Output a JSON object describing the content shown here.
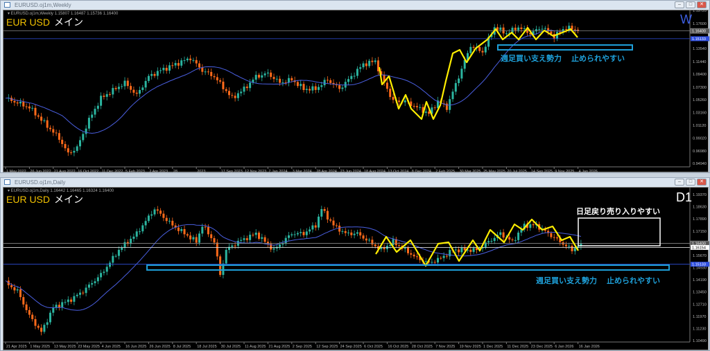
{
  "weekly": {
    "title": "EURUSD.oj1m,Weekly",
    "info": "▾ EURUSD.oj1m,Weekly  1.15807 1.16487 1.15736 1.16400",
    "symbol": "EUR USD",
    "label": "メイン",
    "timeframe": "W",
    "annotation": "週足買い支え勢力　 止められやすい",
    "current_price": "1.16400",
    "support_price": "1.15133"
  },
  "daily": {
    "title": "EURUSD.oj1m,Daily",
    "info": "▾ EURUSD.oj1m,Daily  1.16442 1.16465 1.16324 1.16400",
    "symbol": "EUR USD",
    "label": "メイン",
    "timeframe": "D1",
    "annotation": "週足買い支え勢力　 止められやすい",
    "annotation2": "日足戻り売り入りやすい",
    "current_price": "1.16400",
    "bid_price": "1.16154",
    "support_price": "1.15133"
  },
  "window_controls": {
    "minimize": "–",
    "maximize": "□",
    "close": "✕"
  },
  "colors": {
    "up": "#2bb5a0",
    "down": "#ff6a1a",
    "ma": "#4a5fe0",
    "zigzag": "#ffee00",
    "support": "#1e9fd8"
  },
  "chart_data": [
    {
      "type": "line",
      "title": "EURUSD Weekly",
      "ylim": [
        0.9494,
        1.1972
      ],
      "yticks": [
        "1.19720",
        "1.17600",
        "1.13540",
        "1.11440",
        "1.09400",
        "1.07300",
        "1.05260",
        "1.03160",
        "1.01120",
        "0.99020",
        "0.96980",
        "0.94940"
      ],
      "xticks": [
        "1 May 2022",
        "26 Jun 2022",
        "21 Aug 2022",
        "16 Oct 2022",
        "11 Dec 2022",
        "5 Feb 2023",
        "2 Apr 2023",
        "28",
        "2023",
        "17 Sep 2023",
        "12 Nov 2023",
        "7 Jan 2024",
        "3 Mar 2024",
        "28 Apr 2024",
        "23 Jun 2024",
        "18 Aug 2024",
        "13 Oct 2024",
        "8 Dec 2024",
        "2 Feb 2025",
        "30 Mar 2025",
        "25 May 2025",
        "20 Jul 2025",
        "14 Sep 2025",
        "9 Nov 2025",
        "4 Jan 2026"
      ],
      "n_bars": 193,
      "close_keypoints": [
        [
          0,
          1.055
        ],
        [
          8,
          1.04
        ],
        [
          12,
          1.02
        ],
        [
          18,
          0.99
        ],
        [
          21,
          0.965
        ],
        [
          24,
          0.975
        ],
        [
          28,
          1.02
        ],
        [
          32,
          1.055
        ],
        [
          40,
          1.08
        ],
        [
          44,
          1.06
        ],
        [
          48,
          1.09
        ],
        [
          52,
          1.1
        ],
        [
          62,
          1.12
        ],
        [
          66,
          1.1
        ],
        [
          70,
          1.09
        ],
        [
          76,
          1.055
        ],
        [
          80,
          1.07
        ],
        [
          84,
          1.09
        ],
        [
          88,
          1.095
        ],
        [
          92,
          1.08
        ],
        [
          96,
          1.085
        ],
        [
          100,
          1.07
        ],
        [
          104,
          1.07
        ],
        [
          108,
          1.085
        ],
        [
          112,
          1.07
        ],
        [
          116,
          1.09
        ],
        [
          120,
          1.11
        ],
        [
          124,
          1.115
        ],
        [
          126,
          1.09
        ],
        [
          130,
          1.05
        ],
        [
          134,
          1.05
        ],
        [
          138,
          1.04
        ],
        [
          142,
          1.03
        ],
        [
          145,
          1.05
        ],
        [
          148,
          1.04
        ],
        [
          152,
          1.09
        ],
        [
          156,
          1.14
        ],
        [
          160,
          1.13
        ],
        [
          164,
          1.17
        ],
        [
          168,
          1.16
        ],
        [
          172,
          1.17
        ],
        [
          176,
          1.16
        ],
        [
          180,
          1.17
        ],
        [
          184,
          1.155
        ],
        [
          188,
          1.17
        ],
        [
          192,
          1.164
        ]
      ]
    },
    {
      "type": "line",
      "title": "EURUSD Daily",
      "ylim": [
        1.1049,
        1.1937
      ],
      "yticks": [
        "1.19370",
        "1.18630",
        "1.17890",
        "1.17150",
        "1.15670",
        "1.14930",
        "1.14190",
        "1.13450",
        "1.12710",
        "1.11970",
        "1.11230",
        "1.10490"
      ],
      "xticks": [
        "21 Apr 2025",
        "1 May 2025",
        "13 May 2025",
        "23 May 2025",
        "4 Jun 2025",
        "16 Jun 2025",
        "26 Jun 2025",
        "8 Jul 2025",
        "18 Jul 2025",
        "30 Jul 2025",
        "11 Aug 2025",
        "21 Aug 2025",
        "2 Sep 2025",
        "12 Sep 2025",
        "24 Sep 2025",
        "6 Oct 2025",
        "16 Oct 2025",
        "28 Oct 2025",
        "7 Nov 2025",
        "19 Nov 2025",
        "1 Dec 2025",
        "11 Dec 2025",
        "23 Dec 2025",
        "6 Jan 2026",
        "16 Jan 2026"
      ],
      "n_bars": 194,
      "close_keypoints": [
        [
          0,
          1.14
        ],
        [
          4,
          1.135
        ],
        [
          8,
          1.12
        ],
        [
          12,
          1.11
        ],
        [
          16,
          1.125
        ],
        [
          22,
          1.13
        ],
        [
          26,
          1.135
        ],
        [
          32,
          1.145
        ],
        [
          38,
          1.16
        ],
        [
          44,
          1.17
        ],
        [
          48,
          1.18
        ],
        [
          50,
          1.185
        ],
        [
          56,
          1.175
        ],
        [
          60,
          1.17
        ],
        [
          64,
          1.165
        ],
        [
          66,
          1.175
        ],
        [
          70,
          1.165
        ],
        [
          72,
          1.145
        ],
        [
          74,
          1.16
        ],
        [
          78,
          1.165
        ],
        [
          84,
          1.17
        ],
        [
          90,
          1.16
        ],
        [
          96,
          1.17
        ],
        [
          100,
          1.17
        ],
        [
          104,
          1.175
        ],
        [
          106,
          1.185
        ],
        [
          110,
          1.175
        ],
        [
          114,
          1.17
        ],
        [
          118,
          1.17
        ],
        [
          122,
          1.165
        ],
        [
          126,
          1.16
        ],
        [
          130,
          1.165
        ],
        [
          134,
          1.16
        ],
        [
          138,
          1.155
        ],
        [
          142,
          1.152
        ],
        [
          146,
          1.155
        ],
        [
          150,
          1.16
        ],
        [
          154,
          1.16
        ],
        [
          158,
          1.16
        ],
        [
          162,
          1.165
        ],
        [
          166,
          1.17
        ],
        [
          170,
          1.165
        ],
        [
          174,
          1.175
        ],
        [
          178,
          1.175
        ],
        [
          182,
          1.17
        ],
        [
          186,
          1.165
        ],
        [
          190,
          1.16
        ],
        [
          193,
          1.164
        ]
      ]
    }
  ]
}
